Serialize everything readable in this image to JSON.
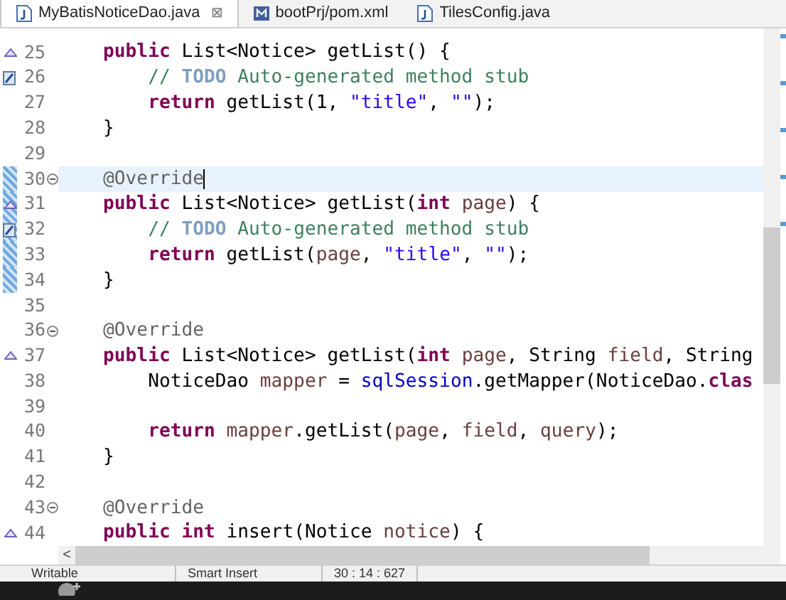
{
  "tabs": [
    {
      "label": "MyBatisNoticeDao.java",
      "selected": true,
      "kind": "java",
      "close": "⊠"
    },
    {
      "label": "bootPrj/pom.xml",
      "selected": false,
      "kind": "xml"
    },
    {
      "label": "TilesConfig.java",
      "selected": false,
      "kind": "java"
    }
  ],
  "lines": [
    {
      "number": "25",
      "kind": "override",
      "tokens": [
        {
          "text": "    public",
          "kind": "keyword"
        },
        {
          "text": " List<Notice> getList() {",
          "kind": "plain"
        }
      ]
    },
    {
      "number": "26",
      "kind": "task",
      "tokens": [
        {
          "text": "        // ",
          "kind": "comment"
        },
        {
          "text": "TODO",
          "kind": "todo"
        },
        {
          "text": " Auto-generated method stub",
          "kind": "comment"
        }
      ]
    },
    {
      "number": "27",
      "kind": "code",
      "tokens": [
        {
          "text": "        return",
          "kind": "keyword"
        },
        {
          "text": " getList(1, ",
          "kind": "plain"
        },
        {
          "text": "\"title\"",
          "kind": "string"
        },
        {
          "text": ", ",
          "kind": "plain"
        },
        {
          "text": "\"\"",
          "kind": "string"
        },
        {
          "text": ");",
          "kind": "plain"
        }
      ]
    },
    {
      "number": "28",
      "kind": "code",
      "tokens": [
        {
          "text": "    }",
          "kind": "plain"
        }
      ]
    },
    {
      "number": "29",
      "kind": "code"
    },
    {
      "number": "30",
      "kind": "code",
      "fold": true,
      "changed": true,
      "current": true,
      "tokens": [
        {
          "text": "    @Override",
          "kind": "annotation"
        }
      ]
    },
    {
      "number": "31",
      "kind": "override",
      "changed": true,
      "tokens": [
        {
          "text": "    public",
          "kind": "keyword"
        },
        {
          "text": " List<Notice> getList(",
          "kind": "plain"
        },
        {
          "text": "int",
          "kind": "keyword"
        },
        {
          "text": " page",
          "kind": "param"
        },
        {
          "text": ") {",
          "kind": "plain"
        }
      ]
    },
    {
      "number": "32",
      "kind": "task",
      "changed": true,
      "tokens": [
        {
          "text": "        // ",
          "kind": "comment"
        },
        {
          "text": "TODO",
          "kind": "todo"
        },
        {
          "text": " Auto-generated method stub",
          "kind": "comment"
        }
      ]
    },
    {
      "number": "33",
      "kind": "code",
      "changed": true,
      "tokens": [
        {
          "text": "        return",
          "kind": "keyword"
        },
        {
          "text": " getList(",
          "kind": "plain"
        },
        {
          "text": "page",
          "kind": "param"
        },
        {
          "text": ", ",
          "kind": "plain"
        },
        {
          "text": "\"title\"",
          "kind": "string"
        },
        {
          "text": ", ",
          "kind": "plain"
        },
        {
          "text": "\"\"",
          "kind": "string"
        },
        {
          "text": ");",
          "kind": "plain"
        }
      ]
    },
    {
      "number": "34",
      "kind": "code",
      "changed": true,
      "tokens": [
        {
          "text": "    }",
          "kind": "plain"
        }
      ]
    },
    {
      "number": "35",
      "kind": "code"
    },
    {
      "number": "36",
      "kind": "code",
      "fold": true,
      "tokens": [
        {
          "text": "    @Override",
          "kind": "annotation"
        }
      ]
    },
    {
      "number": "37",
      "kind": "override",
      "tokens": [
        {
          "text": "    public",
          "kind": "keyword"
        },
        {
          "text": " List<Notice> getList(",
          "kind": "plain"
        },
        {
          "text": "int",
          "kind": "keyword"
        },
        {
          "text": " page",
          "kind": "param"
        },
        {
          "text": ", String ",
          "kind": "plain"
        },
        {
          "text": "field",
          "kind": "param"
        },
        {
          "text": ", String",
          "kind": "plain"
        }
      ]
    },
    {
      "number": "38",
      "kind": "code",
      "tokens": [
        {
          "text": "        NoticeDao ",
          "kind": "plain"
        },
        {
          "text": "mapper",
          "kind": "param"
        },
        {
          "text": " = ",
          "kind": "plain"
        },
        {
          "text": "sqlSession",
          "kind": "field"
        },
        {
          "text": ".getMapper(NoticeDao.",
          "kind": "plain"
        },
        {
          "text": "clas",
          "kind": "keyword"
        }
      ]
    },
    {
      "number": "39",
      "kind": "code"
    },
    {
      "number": "40",
      "kind": "code",
      "tokens": [
        {
          "text": "        return",
          "kind": "keyword"
        },
        {
          "text": " mapper",
          "kind": "param"
        },
        {
          "text": ".getList(",
          "kind": "plain"
        },
        {
          "text": "page",
          "kind": "param"
        },
        {
          "text": ", ",
          "kind": "plain"
        },
        {
          "text": "field",
          "kind": "param"
        },
        {
          "text": ", ",
          "kind": "plain"
        },
        {
          "text": "query",
          "kind": "param"
        },
        {
          "text": ");",
          "kind": "plain"
        }
      ]
    },
    {
      "number": "41",
      "kind": "code",
      "tokens": [
        {
          "text": "    }",
          "kind": "plain"
        }
      ]
    },
    {
      "number": "42",
      "kind": "code"
    },
    {
      "number": "43",
      "kind": "code",
      "fold": true,
      "tokens": [
        {
          "text": "    @Override",
          "kind": "annotation"
        }
      ]
    },
    {
      "number": "44",
      "kind": "override",
      "tokens": [
        {
          "text": "    public",
          "kind": "keyword"
        },
        {
          "text": " int",
          "kind": "keyword"
        },
        {
          "text": " insert(Notice ",
          "kind": "plain"
        },
        {
          "text": "notice",
          "kind": "param"
        },
        {
          "text": ") {",
          "kind": "plain"
        }
      ]
    }
  ],
  "scroll_left": "<",
  "status_bar": [
    "Writable",
    "Smart Insert",
    "30 : 14 : 627"
  ]
}
